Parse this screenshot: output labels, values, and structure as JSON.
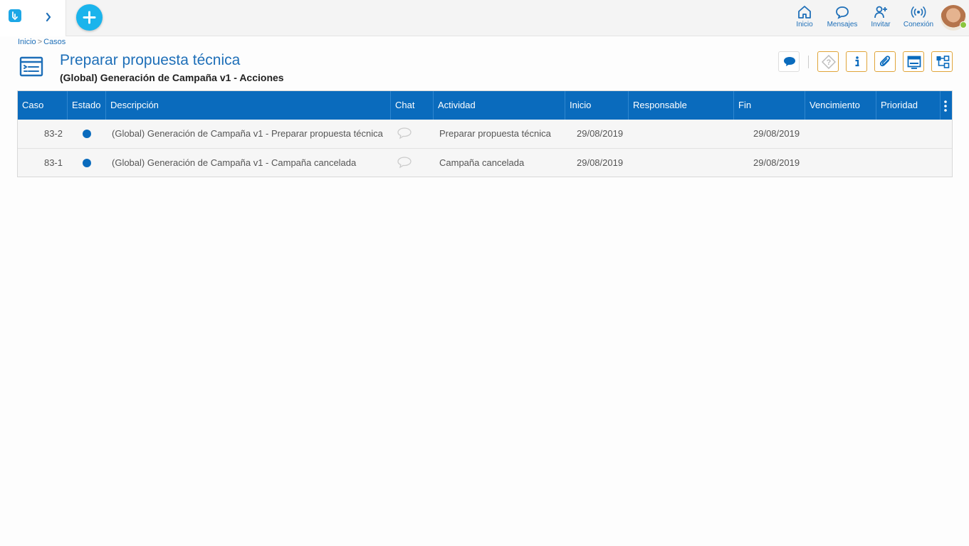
{
  "topbar": {
    "actions": [
      {
        "label": "Inicio",
        "icon": "home-icon"
      },
      {
        "label": "Mensajes",
        "icon": "chat-icon"
      },
      {
        "label": "Invitar",
        "icon": "invite-user-icon"
      },
      {
        "label": "Conexión",
        "icon": "wireless-icon"
      }
    ],
    "accent": "#1ab4ec",
    "status_color": "#8bc53f"
  },
  "breadcrumb": {
    "items": [
      "Inicio",
      "Casos"
    ],
    "separator": ">"
  },
  "page": {
    "title": "Preparar propuesta técnica",
    "subtitle": "(Global) Generación de Campaña v1 - Acciones"
  },
  "toolbar": {
    "buttons": [
      "chat-icon",
      "help-icon",
      "info-icon",
      "attachment-icon",
      "form-icon",
      "workflow-icon"
    ]
  },
  "table": {
    "header_color": "#0a6bbd",
    "columns": [
      "Caso",
      "Estado",
      "Descripción",
      "Chat",
      "Actividad",
      "Inicio",
      "Responsable",
      "Fin",
      "Vencimiento",
      "Prioridad"
    ],
    "rows": [
      {
        "caso": "83-2",
        "estado": "open",
        "descripcion": "(Global) Generación de Campaña v1 - Preparar propuesta técnica",
        "actividad": "Preparar propuesta técnica",
        "inicio": "29/08/2019",
        "responsable": "",
        "fin": "29/08/2019",
        "vencimiento": "",
        "prioridad": ""
      },
      {
        "caso": "83-1",
        "estado": "open",
        "descripcion": "(Global) Generación de Campaña v1 - Campaña cancelada",
        "actividad": "Campaña cancelada",
        "inicio": "29/08/2019",
        "responsable": "",
        "fin": "29/08/2019",
        "vencimiento": "",
        "prioridad": ""
      }
    ]
  }
}
